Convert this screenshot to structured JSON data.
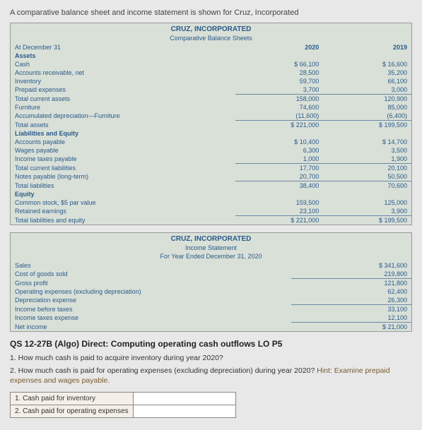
{
  "intro": "A comparative balance sheet and income statement is shown for Cruz, Incorporated",
  "bs": {
    "title": "CRUZ, INCORPORATED",
    "sub": "Comparative Balance Sheets",
    "col_at": "At December 31",
    "y1": "2020",
    "y2": "2019",
    "sections": {
      "assets": "Assets",
      "liab_eq": "Liabilities and Equity",
      "equity": "Equity"
    },
    "rows": {
      "cash": "Cash",
      "ar": "Accounts receivable, net",
      "inv": "Inventory",
      "prepaid": "Prepaid expenses",
      "tca": "Total current assets",
      "furn": "Furniture",
      "accdep": "Accumulated depreciation—Furniture",
      "ta": "Total assets",
      "ap": "Accounts payable",
      "wages": "Wages payable",
      "taxes": "Income taxes payable",
      "tcl": "Total current liabilities",
      "notes": "Notes payable (long-term)",
      "tl": "Total liabilities",
      "cs": "Common stock, $5 par value",
      "re": "Retained earnings",
      "tle": "Total liabilities and equity"
    },
    "v": {
      "cash": [
        "$ 66,100",
        "$ 16,600"
      ],
      "ar": [
        "28,500",
        "35,200"
      ],
      "inv": [
        "59,700",
        "66,100"
      ],
      "prepaid": [
        "3,700",
        "3,000"
      ],
      "tca": [
        "158,000",
        "120,900"
      ],
      "furn": [
        "74,600",
        "85,000"
      ],
      "accdep": [
        "(11,600)",
        "(6,400)"
      ],
      "ta": [
        "$ 221,000",
        "$ 199,500"
      ],
      "ap": [
        "$ 10,400",
        "$ 14,700"
      ],
      "wages": [
        "6,300",
        "3,500"
      ],
      "taxes": [
        "1,000",
        "1,900"
      ],
      "tcl": [
        "17,700",
        "20,100"
      ],
      "notes": [
        "20,700",
        "50,500"
      ],
      "tl": [
        "38,400",
        "70,600"
      ],
      "cs": [
        "159,500",
        "125,000"
      ],
      "re": [
        "23,100",
        "3,900"
      ],
      "tle": [
        "$ 221,000",
        "$ 199,500"
      ]
    }
  },
  "is": {
    "title": "CRUZ, INCORPORATED",
    "sub1": "Income Statement",
    "sub2": "For Year Ended December 31, 2020",
    "rows": {
      "sales": "Sales",
      "cogs": "Cost of goods sold",
      "gp": "Gross profit",
      "opex": "Operating expenses (excluding depreciation)",
      "dep": "Depreciation expense",
      "ibt": "Income before taxes",
      "tax": "Income taxes expense",
      "ni": "Net income"
    },
    "v": {
      "sales": "$ 341,600",
      "cogs": "219,800",
      "gp": "121,800",
      "opex": "62,400",
      "dep": "26,300",
      "ibt": "33,100",
      "tax": "12,100",
      "ni": "$ 21,000"
    }
  },
  "q": {
    "heading": "QS 12-27B (Algo) Direct: Computing operating cash outflows LO P5",
    "q1": "1. How much cash is paid to acquire inventory during year 2020?",
    "q2": "2. How much cash is paid for operating expenses (excluding depreciation) during year 2020? ",
    "hint": "Hint: Examine prepaid expenses and wages payable.",
    "r1": "1. Cash paid for inventory",
    "r2": "2. Cash paid for operating expenses"
  }
}
